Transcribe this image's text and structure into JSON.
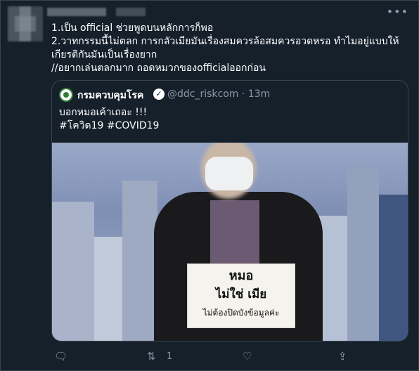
{
  "tweet": {
    "lines": [
      "1.เป็น official ช่วยพูดบนหลักการก็พอ",
      "2.วาทกรรมนี้ไม่ตลก การกลัวเมียมันเรื่องสมควรล้อสมควรอวดหรอ ทำไมอยู่แบบให้",
      "เกียรติกันมันเป็นเรื่องยาก",
      "//อยากเล่นตลกมาก ถอดหมวกของofficialออกก่อน"
    ]
  },
  "quote": {
    "name": "กรมควบคุมโรค",
    "handle": "@ddc_riskcom · 13m",
    "text_line1": "บอกหมอเค้าเถอะ !!!",
    "text_line2": "#โควิด19 #COVID19",
    "sign": {
      "line1": "หมอ",
      "line2": "ไม่ใช่ เมีย",
      "line3": "ไม่ต้องปิดบังข้อมูลค่ะ"
    }
  },
  "actions": {
    "retweet_count": "1"
  },
  "icons": {
    "more": "more-icon",
    "verified": "verified-icon",
    "reply": "reply-icon",
    "retweet": "retweet-icon",
    "like": "like-icon",
    "share": "share-icon"
  }
}
